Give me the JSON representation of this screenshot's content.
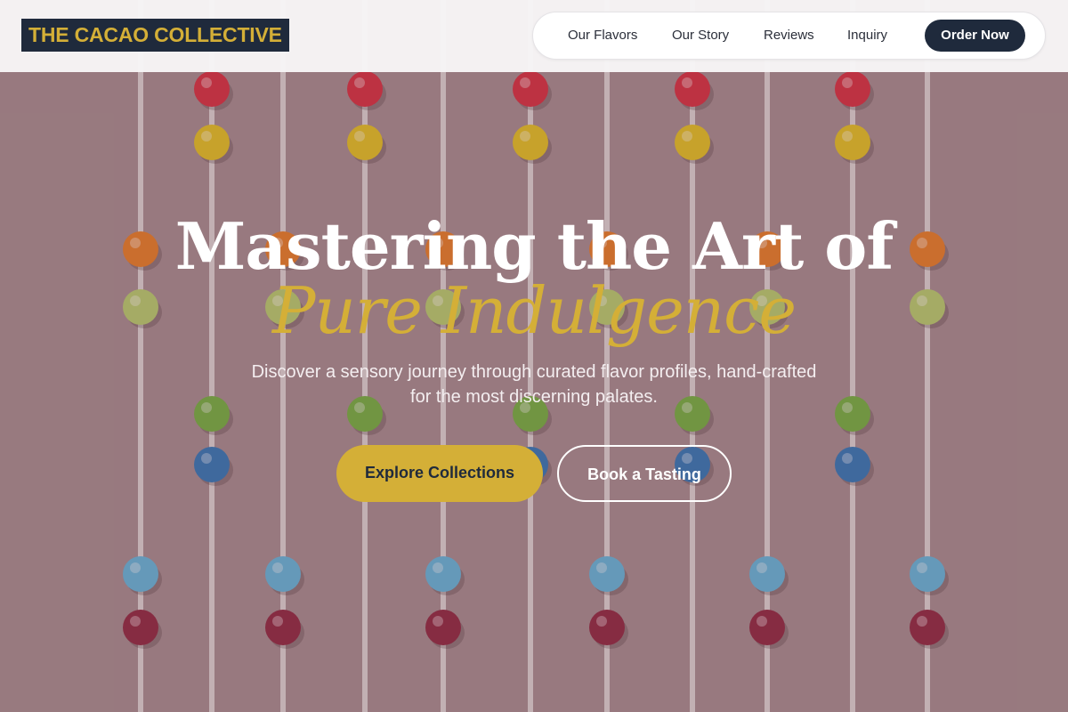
{
  "brand": {
    "name": "THE CACAO COLLECTIVE"
  },
  "nav": {
    "items": [
      "Our Flavors",
      "Our Story",
      "Reviews",
      "Inquiry"
    ],
    "cta": "Order Now"
  },
  "hero": {
    "title_line1": "Mastering the Art of",
    "title_line2": "Pure Indulgence",
    "subtitle": "Discover a sensory journey through curated flavor profiles, hand-crafted for the most discerning palates.",
    "primary_button": "Explore Collections",
    "secondary_button": "Book a Tasting"
  },
  "colors": {
    "accent_gold": "#d4af37",
    "navy": "#1f2a3c",
    "hero_background": "#a58a8e"
  }
}
